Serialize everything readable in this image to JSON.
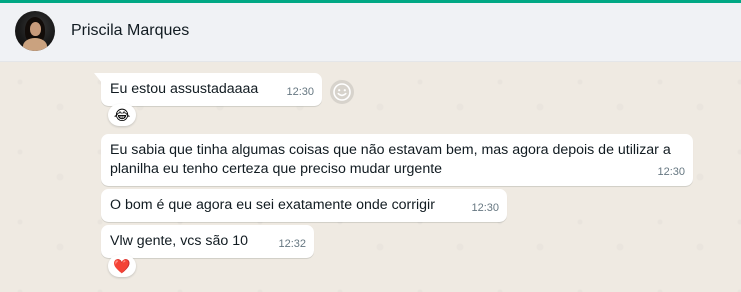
{
  "chat": {
    "contact": {
      "name": "Priscila Marques"
    },
    "accent_color": "#00a884",
    "bubble_color": "#ffffff",
    "messages": [
      {
        "text": "Eu estou assustadaaaa",
        "time": "12:30",
        "reaction": "😂",
        "reaction_icon": "tears-of-joy-emoji-icon"
      },
      {
        "text": "Eu sabia que tinha algumas coisas que não estavam bem, mas agora depois de utilizar a planilha eu tenho certeza que preciso mudar urgente",
        "time": "12:30"
      },
      {
        "text": "O bom é que agora eu sei exatamente onde corrigir",
        "time": "12:30"
      },
      {
        "text": "Vlw gente, vcs são 10",
        "time": "12:32",
        "reaction": "❤️",
        "reaction_icon": "red-heart-emoji-icon"
      }
    ],
    "react_button_icon": "smiley-icon"
  }
}
